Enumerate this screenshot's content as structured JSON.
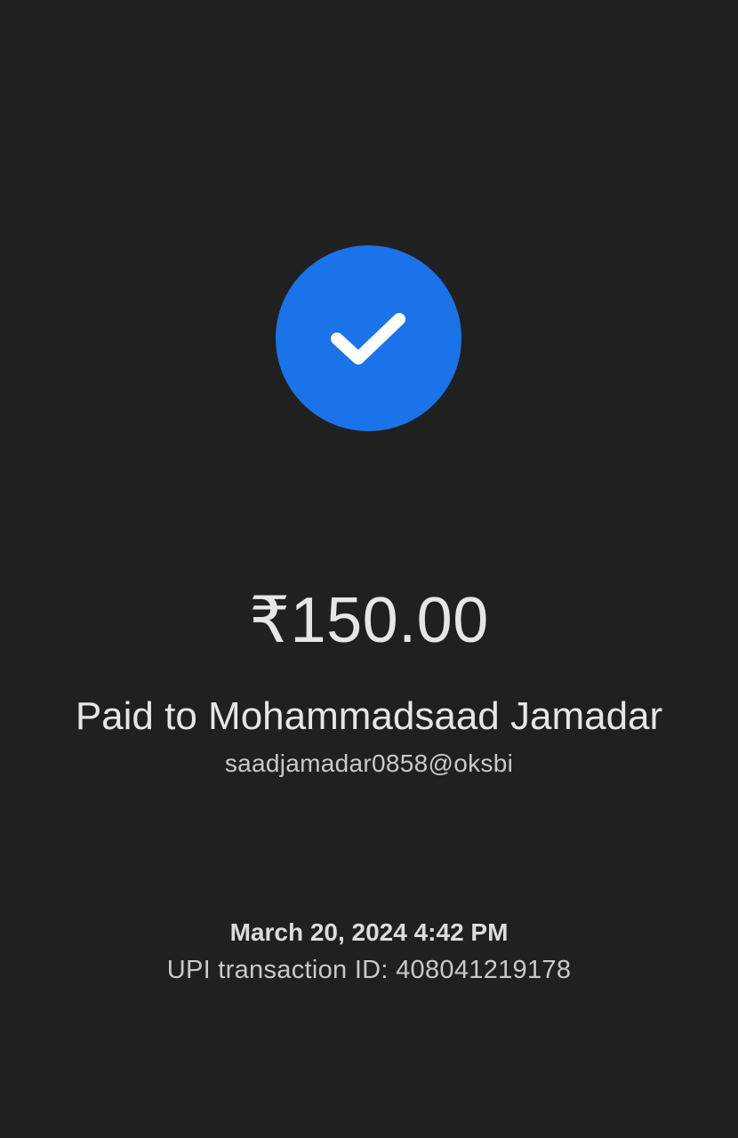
{
  "status": {
    "icon": "check-icon",
    "badge_color": "#1a73e8"
  },
  "payment": {
    "amount": "₹150.00",
    "payee_line": "Paid to Mohammadsaad Jamadar",
    "payee_upi_id": "saadjamadar0858@oksbi"
  },
  "transaction": {
    "datetime": "March 20, 2024 4:42 PM",
    "upi_transaction_id": "UPI transaction ID: 408041219178"
  },
  "colors": {
    "background": "#202020",
    "accent": "#1a73e8"
  }
}
